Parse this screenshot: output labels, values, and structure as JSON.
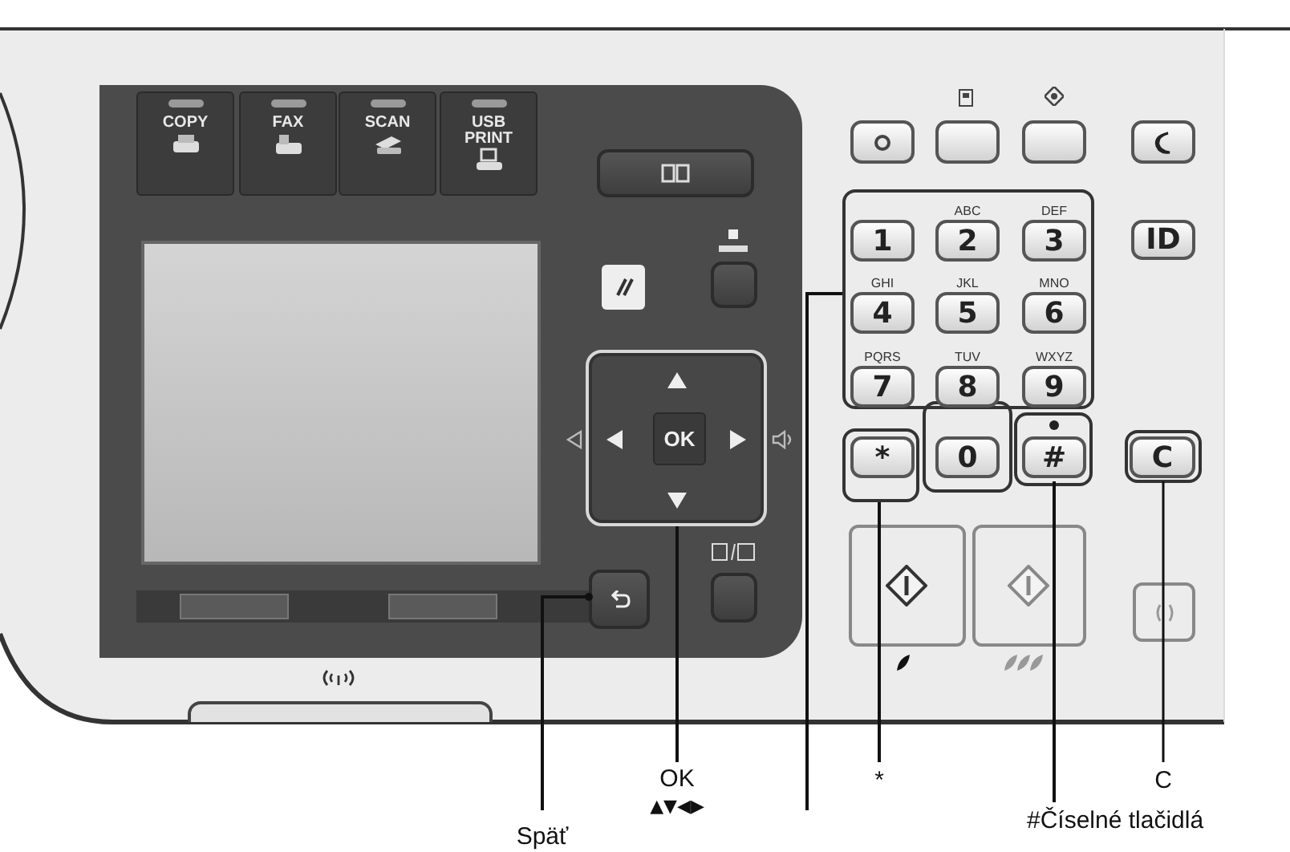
{
  "mode_buttons": [
    {
      "label": "COPY"
    },
    {
      "label": "FAX"
    },
    {
      "label": "SCAN"
    },
    {
      "label": "USB PRINT"
    }
  ],
  "ok_key": {
    "label": "OK"
  },
  "key_letters": [
    {
      "letters": "ABC"
    },
    {
      "letters": "DEF"
    },
    {
      "letters": "GHI"
    },
    {
      "letters": "JKL"
    },
    {
      "letters": "MNO"
    },
    {
      "letters": "PQRS"
    },
    {
      "letters": "TUV"
    },
    {
      "letters": "WXYZ"
    }
  ],
  "keypad": [
    {
      "label": "1"
    },
    {
      "label": "2"
    },
    {
      "label": "3"
    },
    {
      "label": "4"
    },
    {
      "label": "5"
    },
    {
      "label": "6"
    },
    {
      "label": "7"
    },
    {
      "label": "8"
    },
    {
      "label": "9"
    },
    {
      "label": "*"
    },
    {
      "label": "0"
    },
    {
      "label": "#"
    }
  ],
  "side_keys": [
    {
      "label": "ID"
    },
    {
      "label": "C"
    }
  ],
  "callouts": [
    {
      "label": "Späť"
    },
    {
      "label": "OK",
      "sublabel": "▲▼◀▶"
    },
    {
      "label": "*"
    },
    {
      "label": "#Číselné tlačidlá"
    },
    {
      "label": "C"
    }
  ]
}
